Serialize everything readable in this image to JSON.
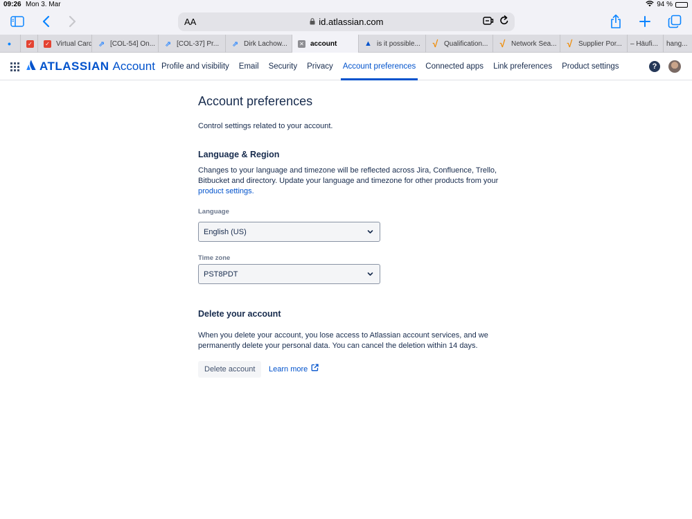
{
  "status_bar": {
    "time": "09:26",
    "date": "Mon 3. Mar",
    "battery": "94 %"
  },
  "browser": {
    "reader_label": "AA",
    "url": "id.atlassian.com",
    "tabs": [
      {
        "label": "",
        "icon": "todoist-icon"
      },
      {
        "label": "Virtual Card",
        "icon": "todoist-icon"
      },
      {
        "label": "[COL-54] On...",
        "icon": "jira-icon"
      },
      {
        "label": "[COL-37] Pr...",
        "icon": "jira-icon"
      },
      {
        "label": "Dirk Lachow...",
        "icon": "jira-icon"
      },
      {
        "label": "account",
        "icon": "close-icon"
      },
      {
        "label": "is it possible...",
        "icon": "atlassian-icon"
      },
      {
        "label": "Qualification...",
        "icon": "v-icon"
      },
      {
        "label": "Network Sea...",
        "icon": "v-icon"
      },
      {
        "label": "Supplier Por...",
        "icon": "v-icon"
      },
      {
        "label": "– Häufi...",
        "icon": ""
      },
      {
        "label": "hang...",
        "icon": ""
      }
    ]
  },
  "header": {
    "brand": "ATLASSIAN",
    "product": "Account",
    "nav": [
      {
        "label": "Profile and visibility"
      },
      {
        "label": "Email"
      },
      {
        "label": "Security"
      },
      {
        "label": "Privacy"
      },
      {
        "label": "Account preferences"
      },
      {
        "label": "Connected apps"
      },
      {
        "label": "Link preferences"
      },
      {
        "label": "Product settings"
      }
    ],
    "help_label": "?"
  },
  "page": {
    "title": "Account preferences",
    "intro": "Control settings related to your account.",
    "language_region": {
      "heading": "Language & Region",
      "description": "Changes to your language and timezone will be reflected across Jira, Confluence, Trello, Bitbucket and directory. Update your language and timezone for other products from your",
      "link": "product settings",
      "link_suffix": ".",
      "language_label": "Language",
      "language_value": "English (US)",
      "timezone_label": "Time zone",
      "timezone_value": "PST8PDT"
    },
    "delete": {
      "heading": "Delete your account",
      "description": "When you delete your account, you lose access to Atlassian account services, and we permanently delete your personal data. You can cancel the deletion within 14 days.",
      "button": "Delete account",
      "learn_more": "Learn more"
    }
  },
  "colors": {
    "brand_blue": "#0052cc",
    "text": "#172b4d",
    "active_bg": "#e9f2ff",
    "safari_blue": "#0a84ff"
  }
}
